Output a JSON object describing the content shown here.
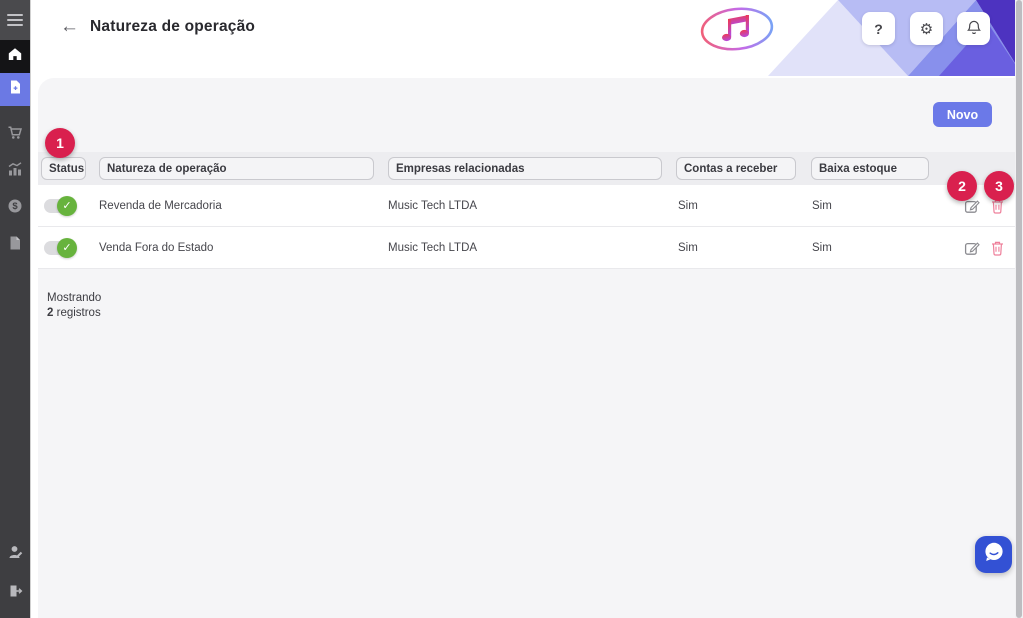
{
  "colors": {
    "accent": "#6b79e8",
    "sidebar_bg": "#3e3e41",
    "sidebar_selected": "#6b79e4",
    "badge_red": "#d9204e",
    "toggle_on_green": "#67b33d",
    "delete_pink": "#ee7f9a",
    "card_bg": "#f5f5f7",
    "deco_purples": [
      "#e1e2f9",
      "#b7bcf4",
      "#8890ec",
      "#4d33c0"
    ]
  },
  "sidebar": {
    "items": [
      {
        "icon": "hamburger-menu-icon"
      },
      {
        "icon": "home-icon",
        "state": "active-dark"
      },
      {
        "icon": "document-plus-icon",
        "state": "selected-blue"
      },
      {
        "icon": "cart-icon"
      },
      {
        "icon": "chart-icon"
      },
      {
        "icon": "dollar-coin-icon"
      },
      {
        "icon": "file-icon"
      }
    ],
    "bottom_items": [
      {
        "icon": "user-edit-icon"
      },
      {
        "icon": "logout-icon"
      }
    ]
  },
  "header": {
    "back_arrow": "←",
    "title": "Natureza de operação",
    "logo": "music-note-logo",
    "actions": {
      "help_label": "?",
      "settings_icon": "⚙",
      "notifications_icon": "bell-icon"
    }
  },
  "toolbar": {
    "new_button_label": "Novo"
  },
  "table": {
    "columns": {
      "status": "Status",
      "natureza": "Natureza de operação",
      "empresas": "Empresas relacionadas",
      "contas": "Contas a receber",
      "baixa": "Baixa estoque"
    },
    "rows": [
      {
        "status_on": true,
        "natureza": "Revenda de Mercadoria",
        "empresas": "Music Tech LTDA",
        "contas": "Sim",
        "baixa": "Sim"
      },
      {
        "status_on": true,
        "natureza": "Venda Fora do Estado",
        "empresas": "Music Tech LTDA",
        "contas": "Sim",
        "baixa": "Sim"
      }
    ]
  },
  "footer": {
    "showing_label": "Mostrando",
    "count": "2",
    "records_label": "registros"
  },
  "annotations": {
    "badges": [
      "1",
      "2",
      "3"
    ]
  },
  "icons": {
    "toggle_check": "✓"
  }
}
